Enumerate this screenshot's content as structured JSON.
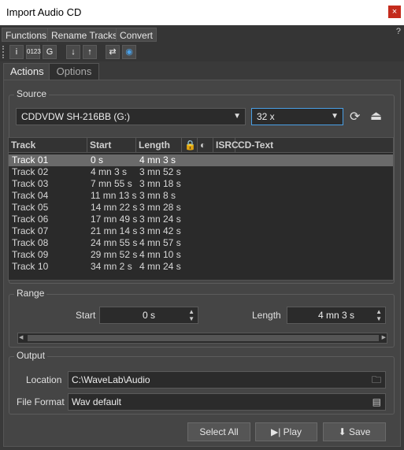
{
  "window": {
    "title": "Import Audio CD",
    "close": "×"
  },
  "menu": {
    "items": [
      "Functions",
      "Rename Tracks",
      "Convert"
    ],
    "help": "?"
  },
  "toolbar": {
    "info": "i",
    "numbering": "0123",
    "refresh": "G",
    "import": "↓",
    "export": "↑",
    "convert": "⇄",
    "cd": "◉"
  },
  "tabs": {
    "actions": "Actions",
    "options": "Options"
  },
  "source": {
    "label": "Source",
    "drive": "CDDVDW SH-216BB (G:)",
    "speed": "32 x"
  },
  "table": {
    "headers": {
      "track": "Track",
      "start": "Start",
      "length": "Length",
      "isrc": "ISRC",
      "cdtext": "CD-Text"
    },
    "rows": [
      {
        "track": "Track 01",
        "start": "0 s",
        "length": "4 mn 3 s"
      },
      {
        "track": "Track 02",
        "start": "4 mn 3 s",
        "length": "3 mn 52 s"
      },
      {
        "track": "Track 03",
        "start": "7 mn 55 s",
        "length": "3 mn 18 s"
      },
      {
        "track": "Track 04",
        "start": "11 mn 13 s",
        "length": "3 mn 8 s"
      },
      {
        "track": "Track 05",
        "start": "14 mn 22 s",
        "length": "3 mn 28 s"
      },
      {
        "track": "Track 06",
        "start": "17 mn 49 s",
        "length": "3 mn 24 s"
      },
      {
        "track": "Track 07",
        "start": "21 mn 14 s",
        "length": "3 mn 42 s"
      },
      {
        "track": "Track 08",
        "start": "24 mn 55 s",
        "length": "4 mn 57 s"
      },
      {
        "track": "Track 09",
        "start": "29 mn 52 s",
        "length": "4 mn 10 s"
      },
      {
        "track": "Track 10",
        "start": "34 mn 2 s",
        "length": "4 mn 24 s"
      }
    ]
  },
  "range": {
    "label": "Range",
    "start_label": "Start",
    "start_value": "0 s",
    "length_label": "Length",
    "length_value": "4 mn 3 s"
  },
  "output": {
    "label": "Output",
    "location_label": "Location",
    "location_value": "C:\\WaveLab\\Audio",
    "format_label": "File Format",
    "format_value": "Wav default"
  },
  "buttons": {
    "select_all": "Select All",
    "play": "Play",
    "save": "Save"
  }
}
